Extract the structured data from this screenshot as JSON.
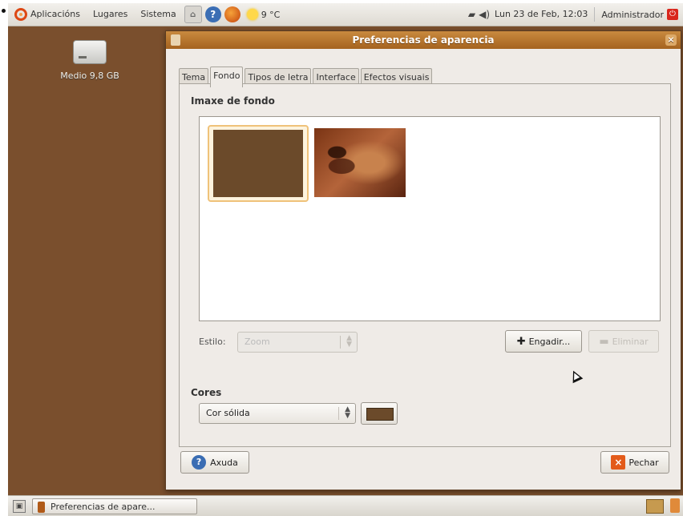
{
  "top_panel": {
    "menus": [
      "Aplicacións",
      "Lugares",
      "Sistema"
    ],
    "weather": "9 °C",
    "clock": "Lun 23 de Feb, 12:03",
    "user": "Administrador"
  },
  "desktop": {
    "icon_label": "Medio 9,8 GB"
  },
  "window": {
    "title": "Preferencias de aparencia",
    "tabs": [
      "Tema",
      "Fondo",
      "Tipos de letra",
      "Interface",
      "Efectos visuais"
    ],
    "active_tab": "Fondo",
    "section_image": "Imaxe de fondo",
    "style_label": "Estilo:",
    "style_value": "Zoom",
    "add_button": "Engadir...",
    "remove_button": "Eliminar",
    "section_colors": "Cores",
    "color_mode": "Cor sólida",
    "swatch_color": "#6b4a2a",
    "help_button": "Axuda",
    "close_button": "Pechar"
  },
  "bottom_panel": {
    "task_label": "Preferencias de apare..."
  }
}
